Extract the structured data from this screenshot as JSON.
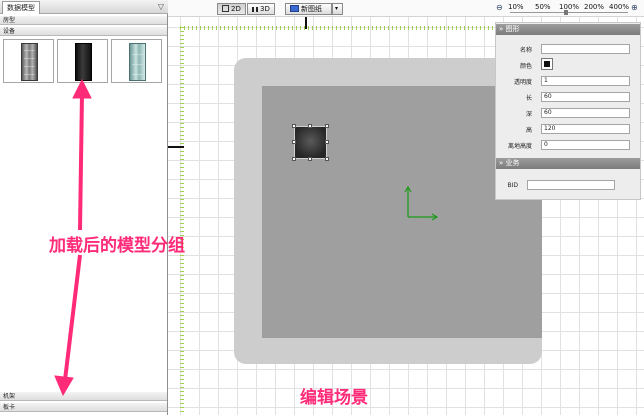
{
  "left_panel": {
    "tab_label": "数据模型",
    "menu_icon": "triangle-down-icon",
    "groups": [
      {
        "label": "房型"
      },
      {
        "label": "设备"
      }
    ],
    "thumbnails": [
      {
        "name": "gray-rack-cabinet"
      },
      {
        "name": "black-rack-cabinet"
      },
      {
        "name": "glass-rack-cabinet"
      }
    ],
    "bottom_groups": [
      {
        "label": "机架"
      },
      {
        "label": "板卡"
      }
    ]
  },
  "toolbar": {
    "view_2d": "2D",
    "view_3d": "3D",
    "new_sheet": "新图纸",
    "dropdown_icon": "chevron-down-icon",
    "zoom_labels": [
      "10%",
      "50%",
      "100%",
      "200%",
      "400%"
    ],
    "zoom_value_percent": 100
  },
  "properties": {
    "section_shape": "图形",
    "fields": [
      {
        "label": "名称",
        "value": ""
      },
      {
        "label": "颜色",
        "value": "#111111"
      },
      {
        "label": "透明度",
        "value": "1"
      },
      {
        "label": "长",
        "value": "60"
      },
      {
        "label": "深",
        "value": "60"
      },
      {
        "label": "高",
        "value": "120"
      },
      {
        "label": "离地高度",
        "value": "0"
      }
    ],
    "section_business": "业务",
    "bid_label": "BID",
    "bid_value": ""
  },
  "annotations": {
    "model_groups": "加载后的模型分组",
    "edit_scene": "编辑场景",
    "color": "#ff2b78"
  }
}
